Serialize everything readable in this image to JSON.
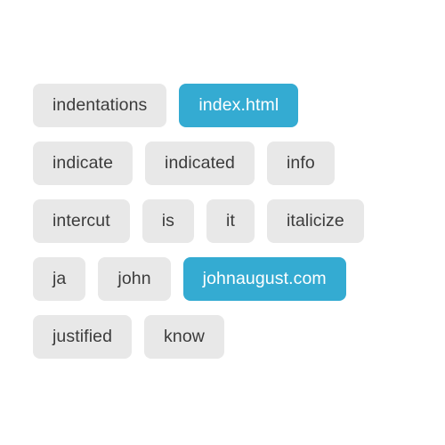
{
  "theme": {
    "page_background": "#ffffff",
    "chip_background": "#e8e8e8",
    "chip_text": "#3c3c3c",
    "chip_highlight_background": "#34abd2",
    "chip_highlight_text": "#ffffff"
  },
  "board": {
    "rows": [
      {
        "chips": [
          {
            "label": "indentations",
            "state": "normal"
          },
          {
            "label": "index.html",
            "state": "highlight"
          }
        ]
      },
      {
        "chips": [
          {
            "label": "indicate",
            "state": "normal"
          },
          {
            "label": "indicated",
            "state": "normal"
          },
          {
            "label": "info",
            "state": "normal"
          }
        ]
      },
      {
        "chips": [
          {
            "label": "intercut",
            "state": "normal"
          },
          {
            "label": "is",
            "state": "normal"
          },
          {
            "label": "it",
            "state": "normal"
          },
          {
            "label": "italicize",
            "state": "normal"
          }
        ]
      },
      {
        "chips": [
          {
            "label": "ja",
            "state": "normal"
          },
          {
            "label": "john",
            "state": "normal"
          },
          {
            "label": "johnaugust.com",
            "state": "highlight"
          }
        ]
      },
      {
        "chips": [
          {
            "label": "justified",
            "state": "normal"
          },
          {
            "label": "know",
            "state": "normal"
          }
        ]
      }
    ]
  }
}
